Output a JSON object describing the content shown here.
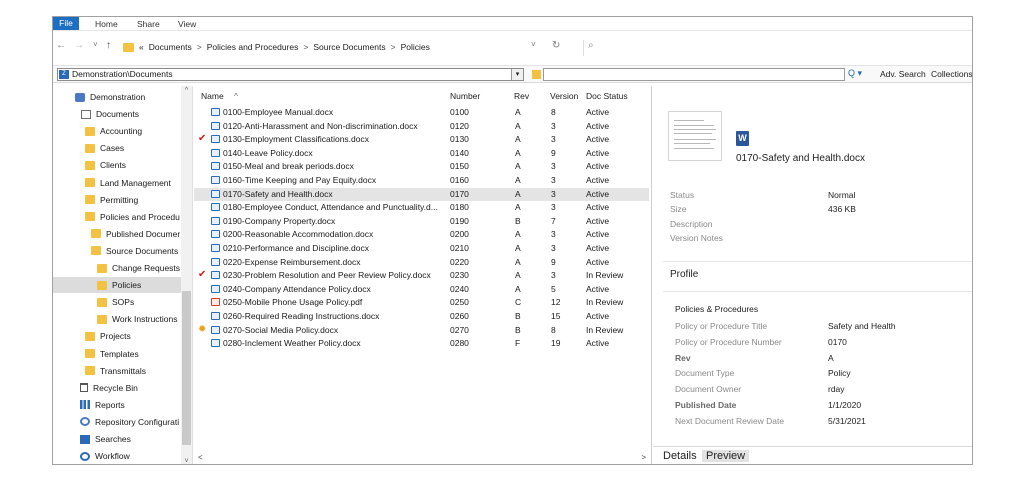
{
  "ribbon": {
    "file": "File",
    "home": "Home",
    "share": "Share",
    "view": "View"
  },
  "address": {
    "prefix": "«",
    "crumbs": [
      "Documents",
      "Policies and Procedures",
      "Source Documents",
      "Policies"
    ],
    "separator": ">",
    "back": "←",
    "forward": "→",
    "recent": "˅",
    "up": "↑",
    "dropdown": "˅",
    "refresh": "↻",
    "search_glyph": "⌕"
  },
  "toolbar": {
    "vault": "Demonstration\\Documents",
    "vault_icon": "Z",
    "dropdown": "▾",
    "search_icons": "Q ▾",
    "adv_search": "Adv. Search",
    "collections": "Collections"
  },
  "tree": [
    {
      "label": "Demonstration",
      "icon": "db"
    },
    {
      "label": "Documents",
      "icon": "doc"
    },
    {
      "label": "Accounting",
      "icon": "folder"
    },
    {
      "label": "Cases",
      "icon": "folder"
    },
    {
      "label": "Clients",
      "icon": "folder"
    },
    {
      "label": "Land Management",
      "icon": "folder"
    },
    {
      "label": "Permitting",
      "icon": "folder"
    },
    {
      "label": "Policies and Procedu",
      "icon": "folder"
    },
    {
      "label": "Published Documer",
      "icon": "folder"
    },
    {
      "label": "Source Documents",
      "icon": "folder"
    },
    {
      "label": "Change Requests",
      "icon": "folder"
    },
    {
      "label": "Policies",
      "icon": "folder"
    },
    {
      "label": "SOPs",
      "icon": "folder"
    },
    {
      "label": "Work Instructions",
      "icon": "folder"
    },
    {
      "label": "Projects",
      "icon": "folder"
    },
    {
      "label": "Templates",
      "icon": "folder"
    },
    {
      "label": "Transmittals",
      "icon": "folder"
    },
    {
      "label": "Recycle Bin",
      "icon": "bin"
    },
    {
      "label": "Reports",
      "icon": "reports"
    },
    {
      "label": "Repository Configurati",
      "icon": "gear"
    },
    {
      "label": "Searches",
      "icon": "search"
    },
    {
      "label": "Workflow",
      "icon": "workflow"
    }
  ],
  "tree_scroll": {
    "up": "^",
    "down": "˅"
  },
  "columns": {
    "name": "Name",
    "sort": "^",
    "number": "Number",
    "rev": "Rev",
    "version": "Version",
    "status": "Doc Status"
  },
  "files": [
    {
      "name": "0100-Employee Manual.docx",
      "number": "0100",
      "rev": "A",
      "version": "8",
      "status": "Active",
      "mark": "",
      "type": "docx"
    },
    {
      "name": "0120-Anti-Harassment and Non-discrimination.docx",
      "number": "0120",
      "rev": "A",
      "version": "3",
      "status": "Active",
      "mark": "",
      "type": "docx"
    },
    {
      "name": "0130-Employment Classifications.docx",
      "number": "0130",
      "rev": "A",
      "version": "3",
      "status": "Active",
      "mark": "✔",
      "type": "docx"
    },
    {
      "name": "0140-Leave Policy.docx",
      "number": "0140",
      "rev": "A",
      "version": "9",
      "status": "Active",
      "mark": "",
      "type": "docx"
    },
    {
      "name": "0150-Meal and break periods.docx",
      "number": "0150",
      "rev": "A",
      "version": "3",
      "status": "Active",
      "mark": "",
      "type": "docx"
    },
    {
      "name": "0160-Time Keeping and Pay Equity.docx",
      "number": "0160",
      "rev": "A",
      "version": "3",
      "status": "Active",
      "mark": "",
      "type": "docx"
    },
    {
      "name": "0170-Safety and Health.docx",
      "number": "0170",
      "rev": "A",
      "version": "3",
      "status": "Active",
      "mark": "",
      "type": "docx"
    },
    {
      "name": "0180-Employee Conduct, Attendance and Punctuality.d...",
      "number": "0180",
      "rev": "A",
      "version": "3",
      "status": "Active",
      "mark": "",
      "type": "docx"
    },
    {
      "name": "0190-Company Property.docx",
      "number": "0190",
      "rev": "B",
      "version": "7",
      "status": "Active",
      "mark": "",
      "type": "docx"
    },
    {
      "name": "0200-Reasonable Accommodation.docx",
      "number": "0200",
      "rev": "A",
      "version": "3",
      "status": "Active",
      "mark": "",
      "type": "docx"
    },
    {
      "name": "0210-Performance and Discipline.docx",
      "number": "0210",
      "rev": "A",
      "version": "3",
      "status": "Active",
      "mark": "",
      "type": "docx"
    },
    {
      "name": "0220-Expense Reimbursement.docx",
      "number": "0220",
      "rev": "A",
      "version": "9",
      "status": "Active",
      "mark": "",
      "type": "docx"
    },
    {
      "name": "0230-Problem Resolution and Peer Review Policy.docx",
      "number": "0230",
      "rev": "A",
      "version": "3",
      "status": "In Review",
      "mark": "✔",
      "type": "docx"
    },
    {
      "name": "0240-Company Attendance Policy.docx",
      "number": "0240",
      "rev": "A",
      "version": "5",
      "status": "Active",
      "mark": "",
      "type": "docx"
    },
    {
      "name": "0250-Mobile Phone Usage Policy.pdf",
      "number": "0250",
      "rev": "C",
      "version": "12",
      "status": "In Review",
      "mark": "",
      "type": "pdf"
    },
    {
      "name": "0260-Required Reading Instructions.docx",
      "number": "0260",
      "rev": "B",
      "version": "15",
      "status": "Active",
      "mark": "",
      "type": "docx"
    },
    {
      "name": "0270-Social Media Policy.docx",
      "number": "0270",
      "rev": "B",
      "version": "8",
      "status": "In Review",
      "mark": "✹",
      "type": "docx"
    },
    {
      "name": "0280-Inclement Weather Policy.docx",
      "number": "0280",
      "rev": "F",
      "version": "19",
      "status": "Active",
      "mark": "",
      "type": "docx"
    }
  ],
  "selected_file_index": 6,
  "list_scroll": {
    "left": "<",
    "right": ">"
  },
  "preview": {
    "word_icon": "W",
    "title": "0170-Safety and Health.docx",
    "meta": [
      {
        "label": "Status",
        "value": "Normal"
      },
      {
        "label": "Size",
        "value": "436 KB"
      },
      {
        "label": "Description",
        "value": ""
      },
      {
        "label": "Version Notes",
        "value": ""
      }
    ],
    "profile_header": "Profile",
    "section": "Policies & Procedures",
    "fields": [
      {
        "label": "Policy or Procedure Title",
        "value": "Safety and Health",
        "bold": false
      },
      {
        "label": "Policy or Procedure Number",
        "value": "0170",
        "bold": false
      },
      {
        "label": "Rev",
        "value": "A",
        "bold": true
      },
      {
        "label": "Document Type",
        "value": "Policy",
        "bold": false
      },
      {
        "label": "Document Owner",
        "value": "rday",
        "bold": false
      },
      {
        "label": "Published Date",
        "value": "1/1/2020",
        "bold": true
      },
      {
        "label": "Next Document Review Date",
        "value": "5/31/2021",
        "bold": false
      }
    ],
    "tabs": [
      "Details",
      "Preview"
    ]
  }
}
